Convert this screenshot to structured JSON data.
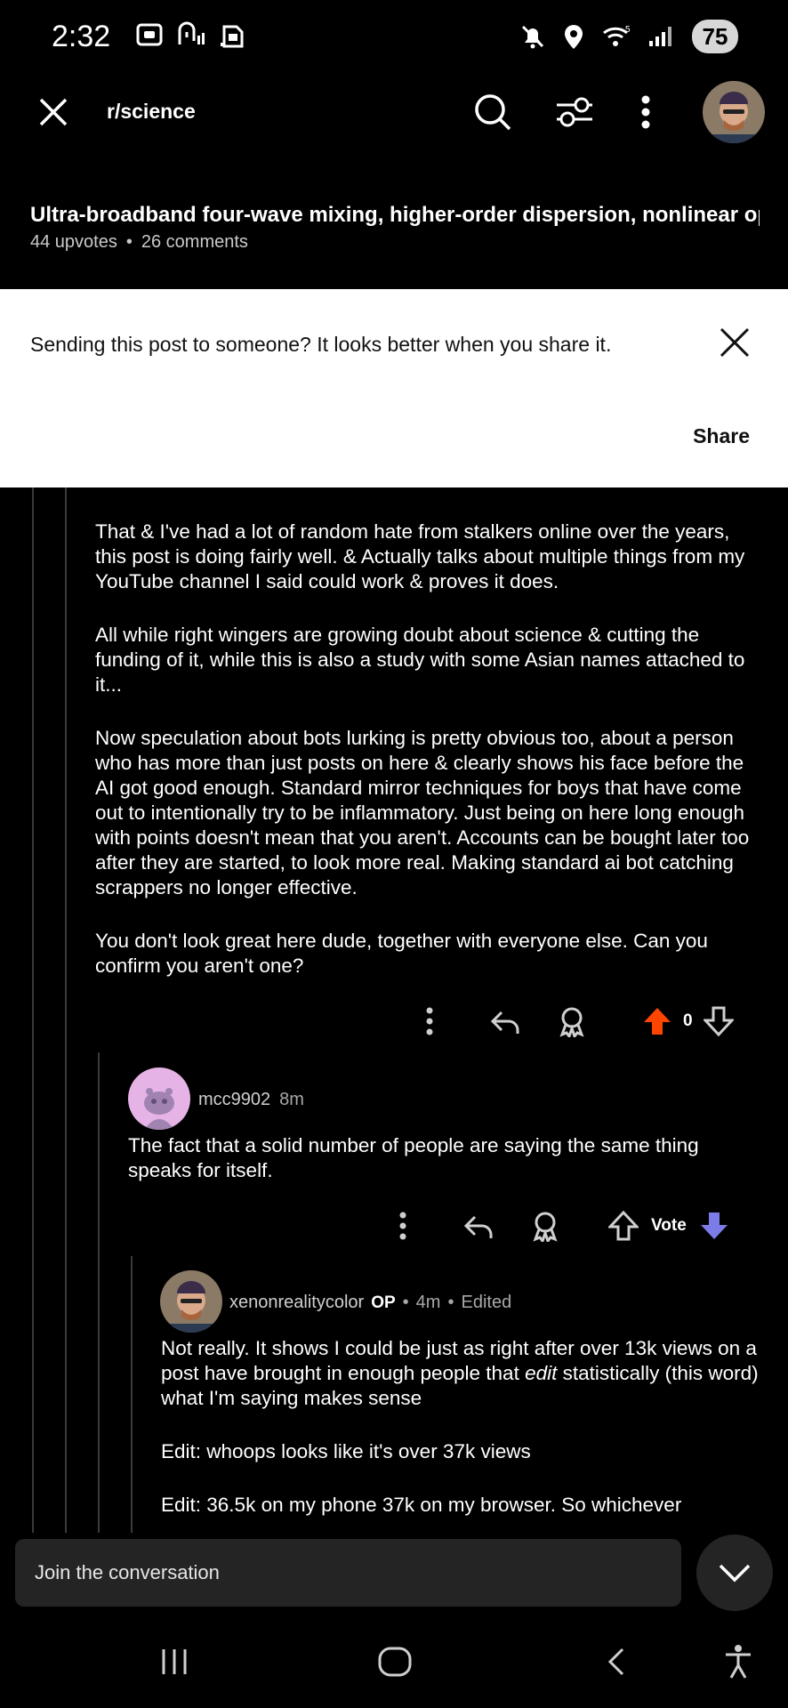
{
  "status_bar": {
    "time": "2:32",
    "battery": "75",
    "icons": [
      "screenshot-icon",
      "nfc-icon",
      "sim-icon",
      "mute-icon",
      "location-icon",
      "wifi-icon",
      "signal-icon"
    ]
  },
  "app_bar": {
    "subreddit": "r/science",
    "icons": [
      "close-icon",
      "search-icon",
      "filter-icon",
      "more-vertical-icon",
      "avatar"
    ]
  },
  "post": {
    "title": "Ultra-broadband four-wave mixing, higher-order dispersion, nonlinear opti...",
    "upvotes": "44 upvotes",
    "comments": "26 comments"
  },
  "share_banner": {
    "message": "Sending this post to someone? It looks better when you share it.",
    "share_label": "Share"
  },
  "comment1": {
    "paragraphs": [
      "That & I've had a lot of random hate from stalkers online over the years, this post is doing fairly well. & Actually talks about multiple things from my YouTube channel I said could work & proves it does.",
      "All while right wingers are growing doubt about science & cutting the funding of it, while this is also a study with some Asian names attached to it...",
      "Now speculation about bots lurking is pretty obvious too, about a person who has more than just posts on here & clearly shows his face before the AI got good enough. Standard mirror techniques for boys that have come out to intentionally try to be inflammatory. Just being on here long enough with points doesn't mean that you aren't. Accounts can be bought later too after they are started, to look more real. Making standard ai bot catching scrappers no longer effective.",
      "You don't look great here dude, together with everyone else. Can you confirm you aren't one?"
    ],
    "vote_count": "0",
    "upvote_color": "#ff4500"
  },
  "comment2": {
    "username": "mcc9902",
    "time": "8m",
    "text": "The fact that a solid number of people are saying the same thing speaks for itself.",
    "vote_label": "Vote",
    "downvote_color": "#7b7ce8"
  },
  "comment3": {
    "username": "xenonrealitycolor",
    "op_badge": "OP",
    "time": "4m",
    "edited": "Edited",
    "text_before_italic": "Not really. It shows I could be just as right after over 13k views on a post have brought in enough people that ",
    "text_italic": "edit",
    "text_after_italic": " statistically (this word) what I'm saying makes sense",
    "edit1": "Edit: whoops looks like it's over 37k views",
    "edit2": "Edit: 36.5k on my phone 37k on my browser. So whichever"
  },
  "composer": {
    "placeholder": "Join the conversation"
  }
}
